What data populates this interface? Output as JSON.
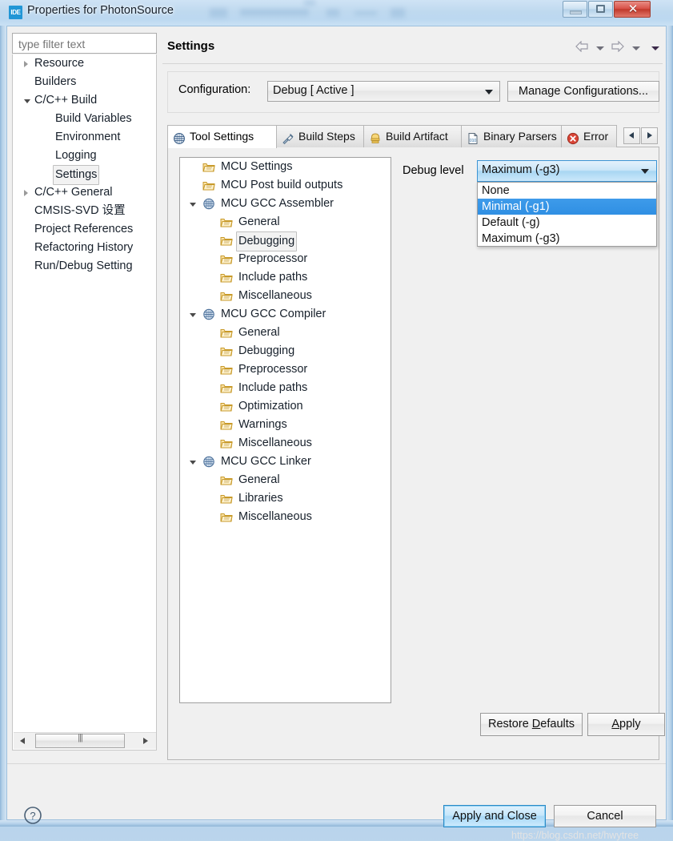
{
  "window": {
    "title": "Properties for PhotonSource",
    "app_icon_text": "IDE",
    "buttons": {
      "minimize": "minimize-button",
      "maximize": "maximize-button",
      "close": "✕"
    }
  },
  "sidebar": {
    "filter": {
      "placeholder": "type filter text",
      "value": ""
    },
    "items": [
      {
        "label": "Resource",
        "indent": 0,
        "arrow": "collapsed",
        "selected": false
      },
      {
        "label": "Builders",
        "indent": 0,
        "arrow": "none",
        "selected": false
      },
      {
        "label": "C/C++ Build",
        "indent": 0,
        "arrow": "expanded",
        "selected": false
      },
      {
        "label": "Build Variables",
        "indent": 1,
        "arrow": "none",
        "selected": false
      },
      {
        "label": "Environment",
        "indent": 1,
        "arrow": "none",
        "selected": false
      },
      {
        "label": "Logging",
        "indent": 1,
        "arrow": "none",
        "selected": false
      },
      {
        "label": "Settings",
        "indent": 1,
        "arrow": "none",
        "selected": true
      },
      {
        "label": "C/C++ General",
        "indent": 0,
        "arrow": "collapsed",
        "selected": false
      },
      {
        "label": "CMSIS-SVD 设置",
        "indent": 0,
        "arrow": "none",
        "selected": false
      },
      {
        "label": "Project References",
        "indent": 0,
        "arrow": "none",
        "selected": false
      },
      {
        "label": "Refactoring History",
        "indent": 0,
        "arrow": "none",
        "selected": false
      },
      {
        "label": "Run/Debug Setting",
        "indent": 0,
        "arrow": "none",
        "selected": false
      }
    ]
  },
  "header": {
    "title": "Settings",
    "nav": [
      "back-arrow-icon",
      "back-dropdown-icon",
      "forward-arrow-icon",
      "forward-dropdown-icon",
      "view-menu-icon"
    ]
  },
  "configuration": {
    "label": "Configuration:",
    "value": "Debug  [ Active ]",
    "manage_label": "Manage Configurations..."
  },
  "tabs": [
    {
      "label": "Tool Settings",
      "icon": "tool-settings-icon",
      "active": true
    },
    {
      "label": "Build Steps",
      "icon": "build-steps-icon",
      "active": false
    },
    {
      "label": "Build Artifact",
      "icon": "build-artifact-icon",
      "active": false
    },
    {
      "label": "Binary Parsers",
      "icon": "binary-parsers-icon",
      "active": false
    },
    {
      "label": "Error",
      "icon": "error-parsers-icon",
      "active": false
    }
  ],
  "tool_tree": [
    {
      "label": "MCU Settings",
      "indent": 1,
      "arrow": "none",
      "icon": "folder",
      "selected": false
    },
    {
      "label": "MCU Post build outputs",
      "indent": 1,
      "arrow": "none",
      "icon": "folder",
      "selected": false
    },
    {
      "label": "MCU GCC Assembler",
      "indent": 1,
      "arrow": "expanded",
      "icon": "tool",
      "selected": false
    },
    {
      "label": "General",
      "indent": 2,
      "arrow": "none",
      "icon": "folder",
      "selected": false
    },
    {
      "label": "Debugging",
      "indent": 2,
      "arrow": "none",
      "icon": "folder",
      "selected": true
    },
    {
      "label": "Preprocessor",
      "indent": 2,
      "arrow": "none",
      "icon": "folder",
      "selected": false
    },
    {
      "label": "Include paths",
      "indent": 2,
      "arrow": "none",
      "icon": "folder",
      "selected": false
    },
    {
      "label": "Miscellaneous",
      "indent": 2,
      "arrow": "none",
      "icon": "folder",
      "selected": false
    },
    {
      "label": "MCU GCC Compiler",
      "indent": 1,
      "arrow": "expanded",
      "icon": "tool",
      "selected": false
    },
    {
      "label": "General",
      "indent": 2,
      "arrow": "none",
      "icon": "folder",
      "selected": false
    },
    {
      "label": "Debugging",
      "indent": 2,
      "arrow": "none",
      "icon": "folder",
      "selected": false
    },
    {
      "label": "Preprocessor",
      "indent": 2,
      "arrow": "none",
      "icon": "folder",
      "selected": false
    },
    {
      "label": "Include paths",
      "indent": 2,
      "arrow": "none",
      "icon": "folder",
      "selected": false
    },
    {
      "label": "Optimization",
      "indent": 2,
      "arrow": "none",
      "icon": "folder",
      "selected": false
    },
    {
      "label": "Warnings",
      "indent": 2,
      "arrow": "none",
      "icon": "folder",
      "selected": false
    },
    {
      "label": "Miscellaneous",
      "indent": 2,
      "arrow": "none",
      "icon": "folder",
      "selected": false
    },
    {
      "label": "MCU GCC Linker",
      "indent": 1,
      "arrow": "expanded",
      "icon": "tool",
      "selected": false
    },
    {
      "label": "General",
      "indent": 2,
      "arrow": "none",
      "icon": "folder",
      "selected": false
    },
    {
      "label": "Libraries",
      "indent": 2,
      "arrow": "none",
      "icon": "folder",
      "selected": false
    },
    {
      "label": "Miscellaneous",
      "indent": 2,
      "arrow": "none",
      "icon": "folder",
      "selected": false
    }
  ],
  "debug_level": {
    "label": "Debug level",
    "value": "Maximum (-g3)",
    "open": true,
    "options": [
      {
        "label": "None",
        "highlighted": false
      },
      {
        "label": "Minimal (-g1)",
        "highlighted": true
      },
      {
        "label": "Default (-g)",
        "highlighted": false
      },
      {
        "label": "Maximum (-g3)",
        "highlighted": false
      }
    ]
  },
  "tab_buttons": {
    "restore_prefix": "Restore ",
    "restore_mnemonic": "D",
    "restore_suffix": "efaults",
    "apply_mnemonic": "A",
    "apply_suffix": "pply"
  },
  "footer": {
    "help": "help-icon",
    "apply_and_close": "Apply and Close",
    "cancel": "Cancel"
  },
  "watermark": "https://blog.csdn.net/hwytree",
  "colors": {
    "selection_blue": "#2f8fe3",
    "combo_focus_border": "#3c94d4",
    "default_button_border": "#2b8ac6",
    "close_button_red": "#c0392b",
    "title_glass": "#bfd9ef"
  }
}
